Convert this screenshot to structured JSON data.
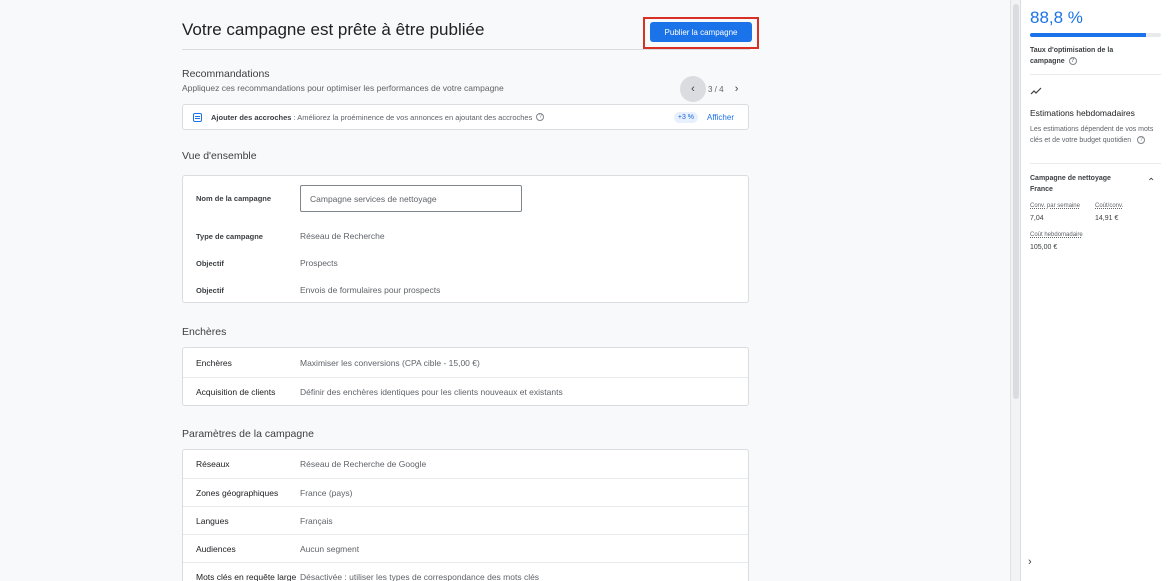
{
  "header": {
    "title": "Votre campagne est prête à être publiée",
    "publish_label": "Publier la campagne"
  },
  "recommendations": {
    "title": "Recommandations",
    "subtitle": "Appliquez ces recommandations pour optimiser les performances de votre campagne",
    "pager": "3 / 4",
    "card": {
      "title": "Ajouter des accroches",
      "text": ": Améliorez la proéminence de vos annonces en ajoutant des accroches",
      "badge": "+3 %",
      "link": "Afficher"
    }
  },
  "overview": {
    "title": "Vue d'ensemble",
    "name_label": "Nom de la campagne",
    "name_value": "Campagne services de nettoyage",
    "rows": [
      {
        "label": "Type de campagne",
        "value": "Réseau de Recherche"
      },
      {
        "label": "Objectif",
        "value": "Prospects"
      },
      {
        "label": "Objectif",
        "value": "Envois de formulaires pour prospects"
      }
    ]
  },
  "bidding": {
    "title": "Enchères",
    "rows": [
      {
        "label": "Enchères",
        "value": "Maximiser les conversions (CPA cible - 15,00 €)"
      },
      {
        "label": "Acquisition de clients",
        "value": "Définir des enchères identiques pour les clients nouveaux et existants"
      }
    ]
  },
  "settings": {
    "title": "Paramètres de la campagne",
    "rows": [
      {
        "label": "Réseaux",
        "value": "Réseau de Recherche de Google"
      },
      {
        "label": "Zones géographiques",
        "value": "France (pays)"
      },
      {
        "label": "Langues",
        "value": "Français"
      },
      {
        "label": "Audiences",
        "value": "Aucun segment"
      },
      {
        "label": "Mots clés en requête large",
        "value": "Désactivée : utiliser les types de correspondance des mots clés"
      }
    ]
  },
  "panel": {
    "score": "88,8 %",
    "score_fraction": 0.888,
    "score_label": "Taux d'optimisation de la campagne",
    "estimates_title": "Estimations hebdomadaires",
    "estimates_desc": "Les estimations dépendent de vos mots clés et de votre budget quotidien",
    "campaign": "Campagne de nettoyage France",
    "metrics": {
      "conv_label": "Conv. par semaine",
      "conv_value": "7,04",
      "cost_conv_label": "Coût/conv.",
      "cost_conv_value": "14,91 €",
      "weekly_cost_label": "Coût hebdomadaire",
      "weekly_cost_value": "105,00 €"
    }
  },
  "colors": {
    "accent": "#1a73e8",
    "highlight_border": "#d93025"
  }
}
